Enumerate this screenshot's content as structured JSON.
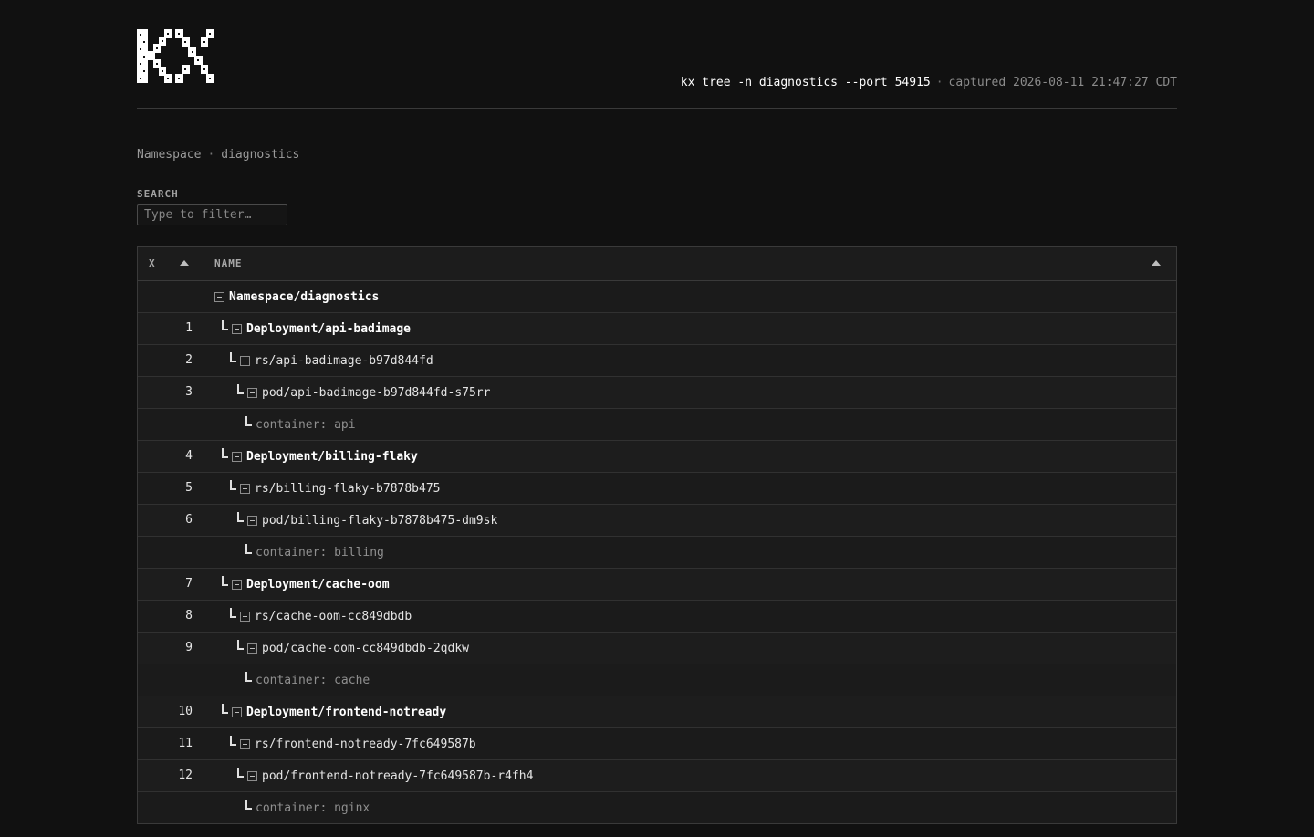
{
  "header": {
    "logo_text": "KX",
    "command": "kx tree -n diagnostics --port 54915",
    "separator": "·",
    "captured": "captured 2026-08-11 21:47:27 CDT"
  },
  "breadcrumb": {
    "label": "Namespace",
    "separator": "·",
    "value": "diagnostics"
  },
  "search": {
    "label": "SEARCH",
    "placeholder": "Type to filter…",
    "value": ""
  },
  "table": {
    "columns": {
      "x": "X",
      "name": "NAME"
    },
    "rows": [
      {
        "index": "",
        "name": "Namespace/diagnostics"
      },
      {
        "index": "1",
        "name": "Deployment/api-badimage"
      },
      {
        "index": "2",
        "name": "rs/api-badimage-b97d844fd"
      },
      {
        "index": "3",
        "name": "pod/api-badimage-b97d844fd-s75rr"
      },
      {
        "index": "",
        "name": "container: api"
      },
      {
        "index": "4",
        "name": "Deployment/billing-flaky"
      },
      {
        "index": "5",
        "name": "rs/billing-flaky-b7878b475"
      },
      {
        "index": "6",
        "name": "pod/billing-flaky-b7878b475-dm9sk"
      },
      {
        "index": "",
        "name": "container: billing"
      },
      {
        "index": "7",
        "name": "Deployment/cache-oom"
      },
      {
        "index": "8",
        "name": "rs/cache-oom-cc849dbdb"
      },
      {
        "index": "9",
        "name": "pod/cache-oom-cc849dbdb-2qdkw"
      },
      {
        "index": "",
        "name": "container: cache"
      },
      {
        "index": "10",
        "name": "Deployment/frontend-notready"
      },
      {
        "index": "11",
        "name": "rs/frontend-notready-7fc649587b"
      },
      {
        "index": "12",
        "name": "pod/frontend-notready-7fc649587b-r4fh4"
      },
      {
        "index": "",
        "name": "container: nginx"
      }
    ]
  },
  "colors": {
    "background": "#111111",
    "table_background": "#1b1b1b",
    "border": "#3a3a3a",
    "text_bright": "#ffffff",
    "text_dim": "#8f8f8f"
  }
}
